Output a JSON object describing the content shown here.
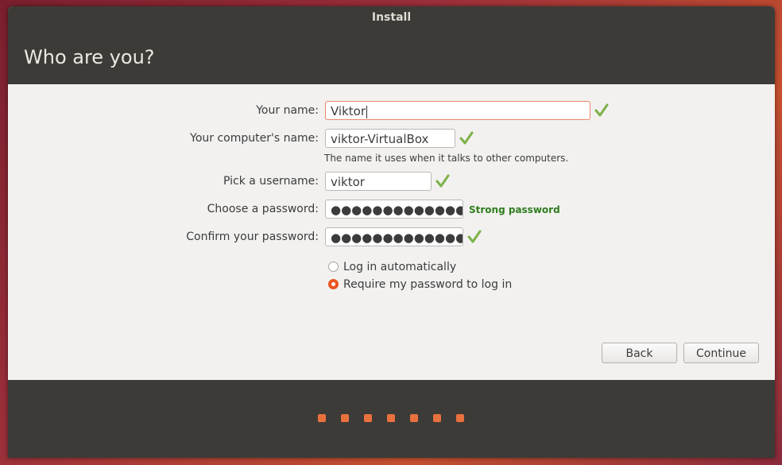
{
  "window": {
    "title": "Install"
  },
  "header": {
    "title": "Who are you?"
  },
  "form": {
    "name_label": "Your name:",
    "name_value": "Viktor",
    "computer_label": "Your computer's name:",
    "computer_value": "viktor-VirtualBox",
    "computer_hint": "The name it uses when it talks to other computers.",
    "username_label": "Pick a username:",
    "username_value": "viktor",
    "password_label": "Choose a password:",
    "password_value": "●●●●●●●●●●●●●",
    "password_strength": "Strong password",
    "confirm_label": "Confirm your password:",
    "confirm_value": "●●●●●●●●●●●●●",
    "login_auto_label": "Log in automatically",
    "login_password_label": "Require my password to log in"
  },
  "buttons": {
    "back": "Back",
    "continue": "Continue"
  },
  "progress": {
    "total_steps": 7
  },
  "colors": {
    "accent": "#e95420",
    "check": "#7db249",
    "strength": "#2f7d1e"
  }
}
